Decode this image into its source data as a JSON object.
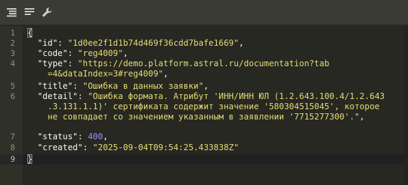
{
  "toolbar": {
    "buttons": [
      {
        "icon": "format-align-icon"
      },
      {
        "icon": "compact-lines-icon"
      },
      {
        "icon": "wrench-icon"
      }
    ]
  },
  "editor": {
    "line_numbers": [
      "1",
      "2",
      "3",
      "4",
      "",
      "5",
      "6",
      "",
      "",
      "7",
      "8",
      "9"
    ],
    "json": {
      "open_brace": "{",
      "close_brace": "}",
      "id_key": "\"id\"",
      "id_value": "\"1d0ee2f1d1b74d469f36cdd7bafe1669\"",
      "code_key": "\"code\"",
      "code_value": "\"reg4009\"",
      "type_key": "\"type\"",
      "type_value_1": "\"https://demo.platform.astral.ru/documentation?tab",
      "type_value_2": "=4&dataIndex=3#reg4009\"",
      "title_key": "\"title\"",
      "title_value": "\"Ошибка в данных заявки\"",
      "detail_key": "\"detail\"",
      "detail_value_1": "\"Ошибка формата. Атрибут 'ИНН/ИНН ЮЛ (1.2.643.100.4/1.2.643",
      "detail_value_2": ".3.131.1.1)' сертификата содержит значение '580304515045', которое",
      "detail_value_3": "не совпадает со значением указанным в заявлении '7715277300'.\"",
      "status_key": "\"status\"",
      "status_value": "400",
      "created_key": "\"created\"",
      "created_value": "\"2025-09-04T09:54:25.433838Z\""
    }
  },
  "colors": {
    "background": "#272822",
    "gutter": "#2f3129",
    "string": "#e6db74",
    "number": "#ae81ff",
    "text": "#f8f8f2"
  }
}
